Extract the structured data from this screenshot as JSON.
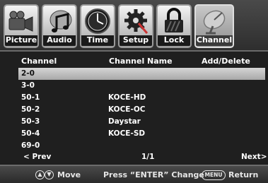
{
  "tabs": [
    {
      "label": "Picture",
      "icon": "camera-icon",
      "active": false
    },
    {
      "label": "Audio",
      "icon": "music-note-icon",
      "active": false
    },
    {
      "label": "Time",
      "icon": "clock-icon",
      "active": false
    },
    {
      "label": "Setup",
      "icon": "gear-icon",
      "active": false
    },
    {
      "label": "Lock",
      "icon": "padlock-icon",
      "active": false
    },
    {
      "label": "Channel",
      "icon": "satellite-dish-icon",
      "active": true
    }
  ],
  "header": {
    "channel": "Channel",
    "channel_name": "Channel Name",
    "add_delete": "Add/Delete"
  },
  "rows": [
    {
      "channel": "2-0",
      "name": "",
      "selected": true
    },
    {
      "channel": "3-0",
      "name": "",
      "selected": false
    },
    {
      "channel": "50-1",
      "name": "KOCE-HD",
      "selected": false
    },
    {
      "channel": "50-2",
      "name": "KOCE-OC",
      "selected": false
    },
    {
      "channel": "50-3",
      "name": "Daystar",
      "selected": false
    },
    {
      "channel": "50-4",
      "name": "KOCE-SD",
      "selected": false
    },
    {
      "channel": "69-0",
      "name": "",
      "selected": false
    }
  ],
  "pager": {
    "prev": "< Prev",
    "page": "1/1",
    "next": "Next>"
  },
  "footer": {
    "move_label": "Move",
    "enter_hint": "Press “ENTER” Change",
    "menu_key": "MENU",
    "return_label": "Return"
  },
  "colors": {
    "selected_row": "#c0c0c0",
    "background": "#1f1f1f"
  }
}
